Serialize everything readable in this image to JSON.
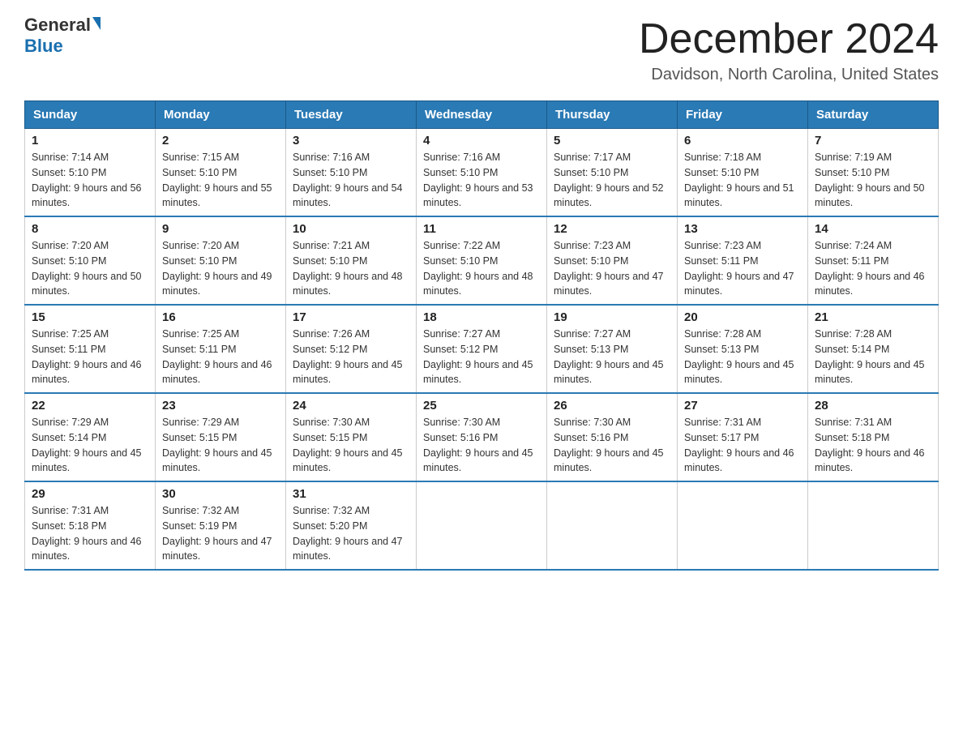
{
  "header": {
    "logo_general": "General",
    "logo_blue": "Blue",
    "month_title": "December 2024",
    "location": "Davidson, North Carolina, United States"
  },
  "days_of_week": [
    "Sunday",
    "Monday",
    "Tuesday",
    "Wednesday",
    "Thursday",
    "Friday",
    "Saturday"
  ],
  "weeks": [
    [
      {
        "day": "1",
        "sunrise": "7:14 AM",
        "sunset": "5:10 PM",
        "daylight": "9 hours and 56 minutes."
      },
      {
        "day": "2",
        "sunrise": "7:15 AM",
        "sunset": "5:10 PM",
        "daylight": "9 hours and 55 minutes."
      },
      {
        "day": "3",
        "sunrise": "7:16 AM",
        "sunset": "5:10 PM",
        "daylight": "9 hours and 54 minutes."
      },
      {
        "day": "4",
        "sunrise": "7:16 AM",
        "sunset": "5:10 PM",
        "daylight": "9 hours and 53 minutes."
      },
      {
        "day": "5",
        "sunrise": "7:17 AM",
        "sunset": "5:10 PM",
        "daylight": "9 hours and 52 minutes."
      },
      {
        "day": "6",
        "sunrise": "7:18 AM",
        "sunset": "5:10 PM",
        "daylight": "9 hours and 51 minutes."
      },
      {
        "day": "7",
        "sunrise": "7:19 AM",
        "sunset": "5:10 PM",
        "daylight": "9 hours and 50 minutes."
      }
    ],
    [
      {
        "day": "8",
        "sunrise": "7:20 AM",
        "sunset": "5:10 PM",
        "daylight": "9 hours and 50 minutes."
      },
      {
        "day": "9",
        "sunrise": "7:20 AM",
        "sunset": "5:10 PM",
        "daylight": "9 hours and 49 minutes."
      },
      {
        "day": "10",
        "sunrise": "7:21 AM",
        "sunset": "5:10 PM",
        "daylight": "9 hours and 48 minutes."
      },
      {
        "day": "11",
        "sunrise": "7:22 AM",
        "sunset": "5:10 PM",
        "daylight": "9 hours and 48 minutes."
      },
      {
        "day": "12",
        "sunrise": "7:23 AM",
        "sunset": "5:10 PM",
        "daylight": "9 hours and 47 minutes."
      },
      {
        "day": "13",
        "sunrise": "7:23 AM",
        "sunset": "5:11 PM",
        "daylight": "9 hours and 47 minutes."
      },
      {
        "day": "14",
        "sunrise": "7:24 AM",
        "sunset": "5:11 PM",
        "daylight": "9 hours and 46 minutes."
      }
    ],
    [
      {
        "day": "15",
        "sunrise": "7:25 AM",
        "sunset": "5:11 PM",
        "daylight": "9 hours and 46 minutes."
      },
      {
        "day": "16",
        "sunrise": "7:25 AM",
        "sunset": "5:11 PM",
        "daylight": "9 hours and 46 minutes."
      },
      {
        "day": "17",
        "sunrise": "7:26 AM",
        "sunset": "5:12 PM",
        "daylight": "9 hours and 45 minutes."
      },
      {
        "day": "18",
        "sunrise": "7:27 AM",
        "sunset": "5:12 PM",
        "daylight": "9 hours and 45 minutes."
      },
      {
        "day": "19",
        "sunrise": "7:27 AM",
        "sunset": "5:13 PM",
        "daylight": "9 hours and 45 minutes."
      },
      {
        "day": "20",
        "sunrise": "7:28 AM",
        "sunset": "5:13 PM",
        "daylight": "9 hours and 45 minutes."
      },
      {
        "day": "21",
        "sunrise": "7:28 AM",
        "sunset": "5:14 PM",
        "daylight": "9 hours and 45 minutes."
      }
    ],
    [
      {
        "day": "22",
        "sunrise": "7:29 AM",
        "sunset": "5:14 PM",
        "daylight": "9 hours and 45 minutes."
      },
      {
        "day": "23",
        "sunrise": "7:29 AM",
        "sunset": "5:15 PM",
        "daylight": "9 hours and 45 minutes."
      },
      {
        "day": "24",
        "sunrise": "7:30 AM",
        "sunset": "5:15 PM",
        "daylight": "9 hours and 45 minutes."
      },
      {
        "day": "25",
        "sunrise": "7:30 AM",
        "sunset": "5:16 PM",
        "daylight": "9 hours and 45 minutes."
      },
      {
        "day": "26",
        "sunrise": "7:30 AM",
        "sunset": "5:16 PM",
        "daylight": "9 hours and 45 minutes."
      },
      {
        "day": "27",
        "sunrise": "7:31 AM",
        "sunset": "5:17 PM",
        "daylight": "9 hours and 46 minutes."
      },
      {
        "day": "28",
        "sunrise": "7:31 AM",
        "sunset": "5:18 PM",
        "daylight": "9 hours and 46 minutes."
      }
    ],
    [
      {
        "day": "29",
        "sunrise": "7:31 AM",
        "sunset": "5:18 PM",
        "daylight": "9 hours and 46 minutes."
      },
      {
        "day": "30",
        "sunrise": "7:32 AM",
        "sunset": "5:19 PM",
        "daylight": "9 hours and 47 minutes."
      },
      {
        "day": "31",
        "sunrise": "7:32 AM",
        "sunset": "5:20 PM",
        "daylight": "9 hours and 47 minutes."
      },
      null,
      null,
      null,
      null
    ]
  ],
  "labels": {
    "sunrise": "Sunrise:",
    "sunset": "Sunset:",
    "daylight": "Daylight:"
  }
}
